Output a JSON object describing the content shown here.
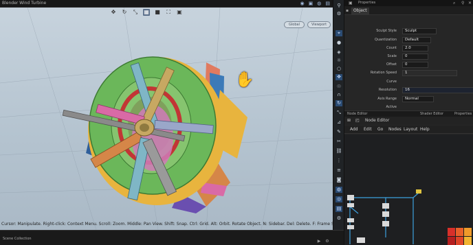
{
  "top": {
    "title": "Blender Wind Turbine",
    "icons": [
      "eye-icon",
      "camera-icon",
      "globe-icon",
      "render-icon"
    ]
  },
  "viewport": {
    "toolbar": [
      "move-icon",
      "rotate-icon",
      "scale-icon",
      "grid-icon",
      "square-icon",
      "transform-icon",
      "frame-icon"
    ],
    "pills": [
      "Global",
      "Viewport"
    ],
    "status": "Cursor: Manipulate. Right-click: Context Menu. Scroll: Zoom. Middle: Pan View. Shift: Snap. Ctrl: Grid. Alt: Orbit. Rotate Object. N: Sidebar. Del: Delete. F: Frame Selected",
    "palette": {
      "green": "#6bb75a",
      "red": "#c23535",
      "pink": "#d96aa6",
      "teal": "#7fb6c6",
      "orange": "#d58648",
      "yellow": "#e8b43e",
      "gray": "#9a9a9a",
      "hub": "#c7a862"
    }
  },
  "bottom": {
    "label": "Scene Collection",
    "icons": [
      "play-icon",
      "settings-icon"
    ]
  },
  "panel": {
    "header_title": "Properties",
    "tab_label": "Object",
    "props": [
      {
        "label": "Sculpt Style",
        "value": "Sculpt"
      },
      {
        "label": "Quantization",
        "value": "Default"
      },
      {
        "label": "Count",
        "value": "2.0"
      },
      {
        "label": "Scale",
        "value": "0"
      },
      {
        "label": "Offset",
        "value": "0"
      },
      {
        "label": "Rotation Speed",
        "value": "1"
      },
      {
        "label": "Curve",
        "value": ""
      },
      {
        "label": "Resolution",
        "value": "16"
      },
      {
        "label": "Axis Range",
        "value": "Normal"
      },
      {
        "label": "Active",
        "value": ""
      }
    ],
    "separator": [
      "Node Editor",
      "Shader Editor",
      "Properties"
    ],
    "node_header": "Node Editor",
    "node_menu": [
      "Add",
      "Edit",
      "Go",
      "Nodes",
      "Layout",
      "Help"
    ]
  }
}
